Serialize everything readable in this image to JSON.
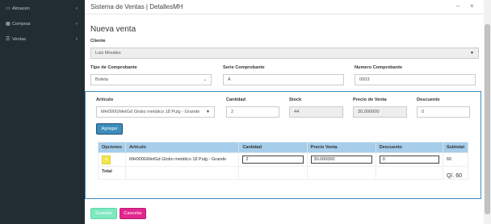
{
  "sidebar": {
    "items": [
      {
        "icon": "desktop-icon",
        "glyph": "▭",
        "label": "Almacén"
      },
      {
        "icon": "grid-icon",
        "glyph": "▦",
        "label": "Compras"
      },
      {
        "icon": "list-icon",
        "glyph": "☰",
        "label": "Ventas"
      }
    ]
  },
  "window": {
    "title": "Sistema de Ventas | DetallesMH"
  },
  "form": {
    "heading": "Nueva venta",
    "cliente_label": "Cliente",
    "cliente_value": "Luis Morales",
    "tipo_label": "Tipo de Comprobante",
    "tipo_value": "Boleta",
    "serie_label": "Serie Comprobante",
    "serie_value": "A",
    "numero_label": "Numero Comprobante",
    "numero_value": "0003"
  },
  "panel": {
    "articulo_label": "Artículo",
    "articulo_value": "MH000GMetGd Globo metálico 18 Pulg - Grande",
    "cantidad_label": "Cantidad",
    "cantidad_value": "2",
    "stock_label": "Stock",
    "stock_value": "44",
    "precio_label": "Precio de Venta",
    "precio_value": "30.000000",
    "descuento_label": "Descuento",
    "descuento_value": "0",
    "agregar_label": "Agregar"
  },
  "table": {
    "headers": [
      "Opciones",
      "Artículo",
      "Cantidad",
      "Precio Venta",
      "Descuento",
      "Subtotal"
    ],
    "rows": [
      {
        "delete_glyph": "x",
        "articulo": "MH000GMetGd Globo metálico 18 Pulg - Grande",
        "cantidad": "2",
        "precio": "30.000000",
        "descuento": "0",
        "subtotal": "60"
      }
    ],
    "total_label": "Total",
    "total_value": "Q/. 60"
  },
  "actions": {
    "guardar_label": "Guardar",
    "cancelar_label": "Cancelar"
  },
  "colors": {
    "sidebar_bg": "#222d32",
    "accent_blue": "#3c8dbc",
    "guardar_bg": "#6fe6b9",
    "cancelar_bg": "#e91e8c"
  }
}
